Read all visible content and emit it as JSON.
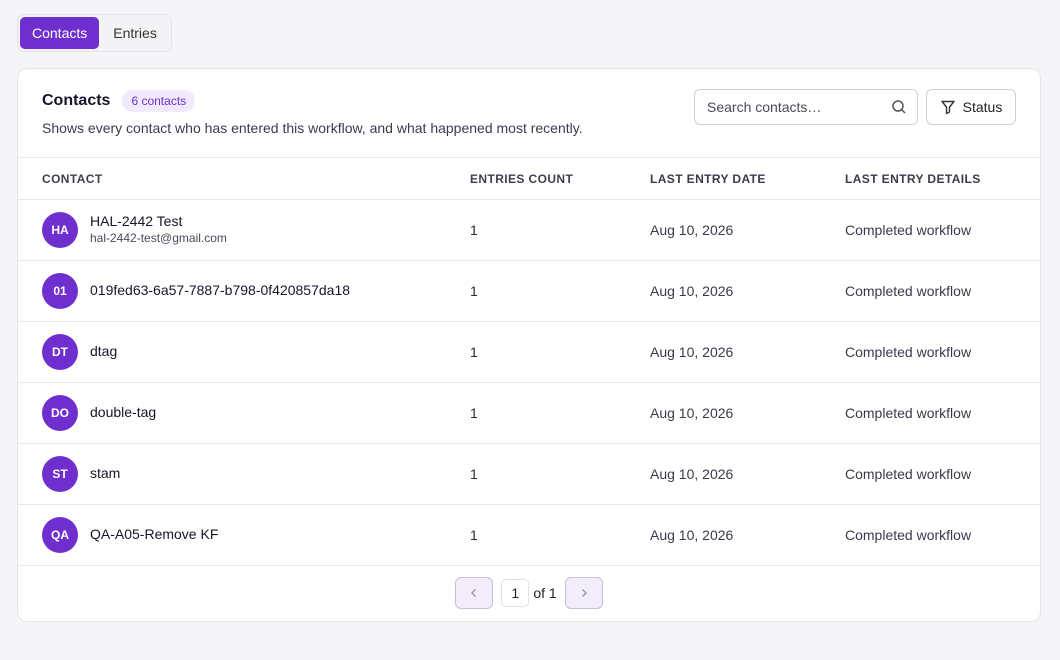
{
  "tabs": [
    {
      "label": "Contacts",
      "active": true
    },
    {
      "label": "Entries",
      "active": false
    }
  ],
  "card": {
    "title": "Contacts",
    "count_badge": "6 contacts",
    "subtitle": "Shows every contact who has entered this workflow, and what happened most recently.",
    "search_placeholder": "Search contacts…",
    "status_label": "Status"
  },
  "table": {
    "headers": [
      "CONTACT",
      "ENTRIES COUNT",
      "LAST ENTRY DATE",
      "LAST ENTRY DETAILS"
    ],
    "rows": [
      {
        "initials": "HA",
        "name": "HAL-2442 Test",
        "email": "hal-2442-test@gmail.com",
        "entries": "1",
        "date": "Aug 10, 2026",
        "details": "Completed workflow"
      },
      {
        "initials": "01",
        "name": "019fed63-6a57-7887-b798-0f420857da18",
        "email": "",
        "entries": "1",
        "date": "Aug 10, 2026",
        "details": "Completed workflow"
      },
      {
        "initials": "DT",
        "name": "dtag",
        "email": "",
        "entries": "1",
        "date": "Aug 10, 2026",
        "details": "Completed workflow"
      },
      {
        "initials": "DO",
        "name": "double-tag",
        "email": "",
        "entries": "1",
        "date": "Aug 10, 2026",
        "details": "Completed workflow"
      },
      {
        "initials": "ST",
        "name": "stam",
        "email": "",
        "entries": "1",
        "date": "Aug 10, 2026",
        "details": "Completed workflow"
      },
      {
        "initials": "QA",
        "name": "QA-A05-Remove KF",
        "email": "",
        "entries": "1",
        "date": "Aug 10, 2026",
        "details": "Completed workflow"
      }
    ]
  },
  "pagination": {
    "current_page": "1",
    "of_label": "of 1"
  },
  "colors": {
    "accent": "#6f2fcf",
    "background": "#f5f5f7"
  },
  "icons": {
    "search": "search-icon",
    "filter": "filter-icon",
    "prev": "chevron-left-icon",
    "next": "chevron-right-icon"
  }
}
